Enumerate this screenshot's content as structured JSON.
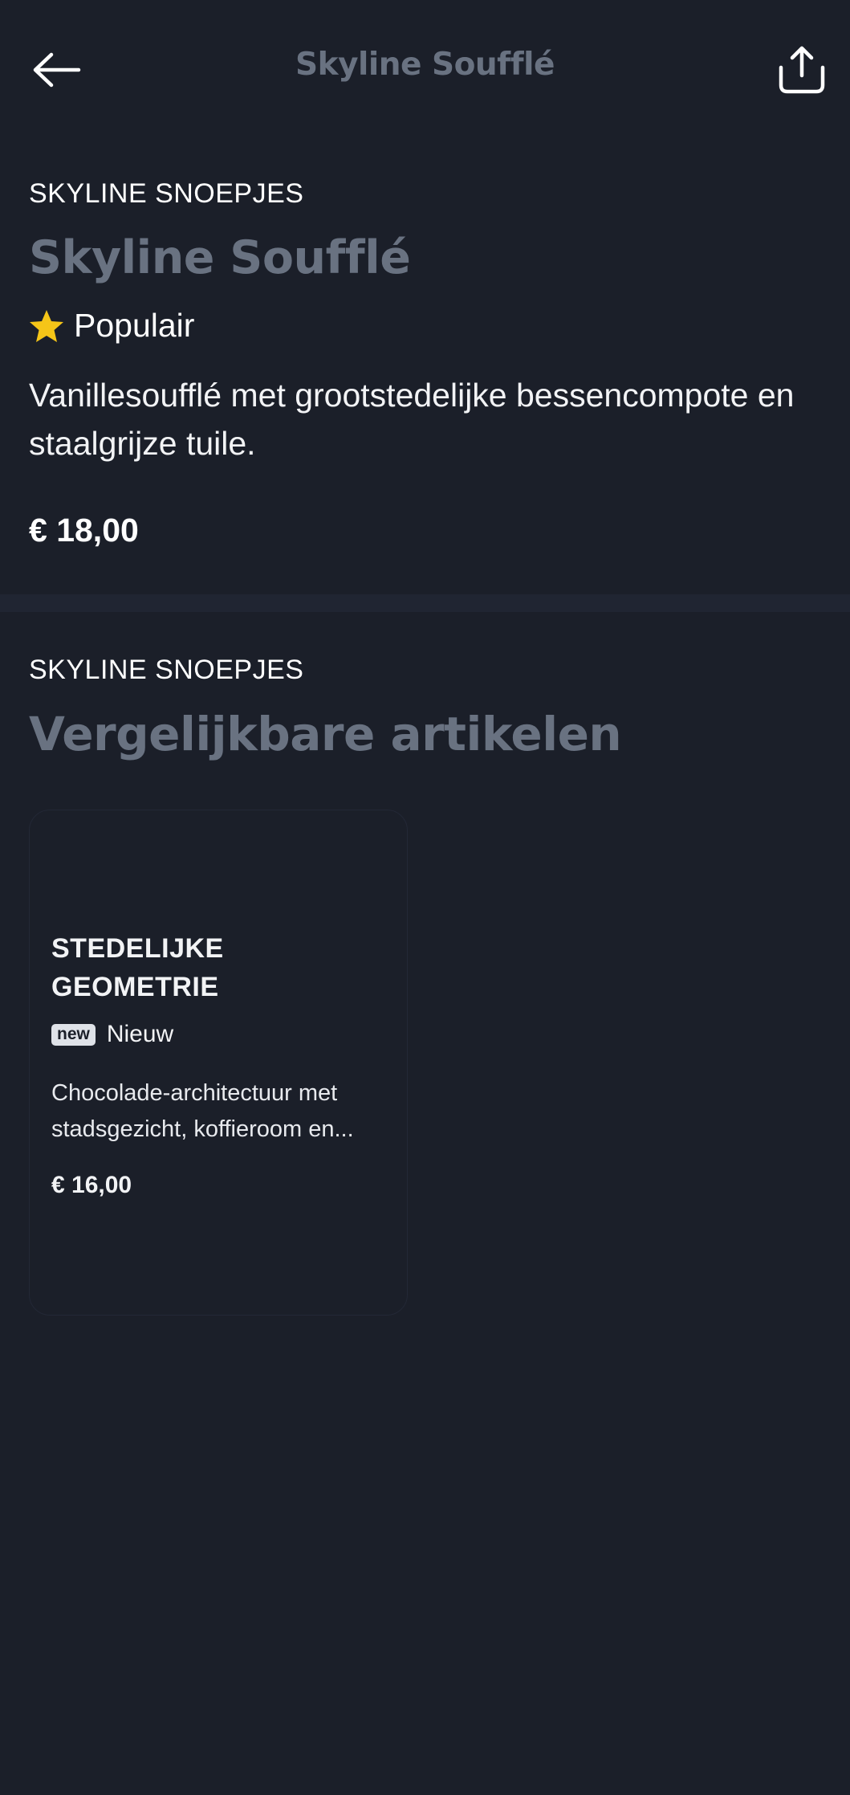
{
  "header": {
    "title": "Skyline Soufflé"
  },
  "product": {
    "brand": "SKYLINE SNOEPJES",
    "name": "Skyline Soufflé",
    "tag_label": "Populair",
    "description": "Vanillesoufflé met grootstedelijke bessencompote en staalgrijze tuile.",
    "price": "€ 18,00"
  },
  "similar": {
    "brand": "SKYLINE SNOEPJES",
    "heading": "Vergelijkbare artikelen",
    "items": [
      {
        "title": "STEDELIJKE GEOMETRIE",
        "badge": "new",
        "badge_label": "Nieuw",
        "description": "Chocolade-architectuur met stadsgezicht, koffieroom en...",
        "price": "€ 16,00"
      }
    ]
  },
  "colors": {
    "background": "#1b1f29",
    "muted_title": "#697281",
    "star": "#f5c518",
    "divider": "#202532"
  }
}
